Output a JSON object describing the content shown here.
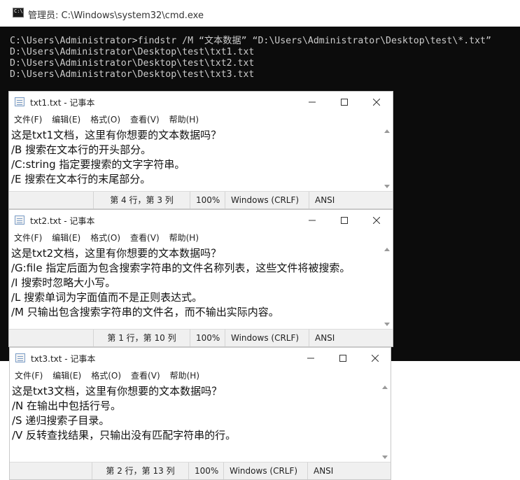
{
  "cmd": {
    "title": "管理员: C:\\Windows\\system32\\cmd.exe",
    "lines": [
      "C:\\Users\\Administrator>findstr /M “文本数据” “D:\\Users\\Administrator\\Desktop\\test\\*.txt”",
      "D:\\Users\\Administrator\\Desktop\\test\\txt1.txt",
      "D:\\Users\\Administrator\\Desktop\\test\\txt2.txt",
      "D:\\Users\\Administrator\\Desktop\\test\\txt3.txt"
    ]
  },
  "menu": [
    "文件(F)",
    "编辑(E)",
    "格式(O)",
    "查看(V)",
    "帮助(H)"
  ],
  "notepads": [
    {
      "title": "txt1.txt - 记事本",
      "lines": [
        "这是txt1文档，这里有你想要的文本数据吗？",
        "/B 搜索在文本行的开头部分。",
        "/C:string 指定要搜索的文字字符串。",
        "/E 搜索在文本行的末尾部分。"
      ],
      "status": {
        "position": "第 4 行，第 3 列",
        "zoom": "100%",
        "eol": "Windows (CRLF)",
        "encoding": "ANSI"
      }
    },
    {
      "title": "txt2.txt - 记事本",
      "lines": [
        "这是txt2文档，这里有你想要的文本数据吗？",
        "/G:file 指定后面为包含搜索字符串的文件名称列表，这些文件将被搜索。",
        "/I 搜索时忽略大小写。",
        "/L 搜索单词为字面值而不是正则表达式。",
        "/M 只输出包含搜索字符串的文件名，而不输出实际内容。"
      ],
      "status": {
        "position": "第 1 行，第 10 列",
        "zoom": "100%",
        "eol": "Windows (CRLF)",
        "encoding": "ANSI"
      }
    },
    {
      "title": "txt3.txt - 记事本",
      "lines": [
        "这是txt3文档，这里有你想要的文本数据吗？",
        "/N 在输出中包括行号。",
        "/S 递归搜索子目录。",
        "/V 反转查找结果，只输出没有匹配字符串的行。"
      ],
      "status": {
        "position": "第 2 行，第 13 列",
        "zoom": "100%",
        "eol": "Windows (CRLF)",
        "encoding": "ANSI"
      }
    }
  ]
}
